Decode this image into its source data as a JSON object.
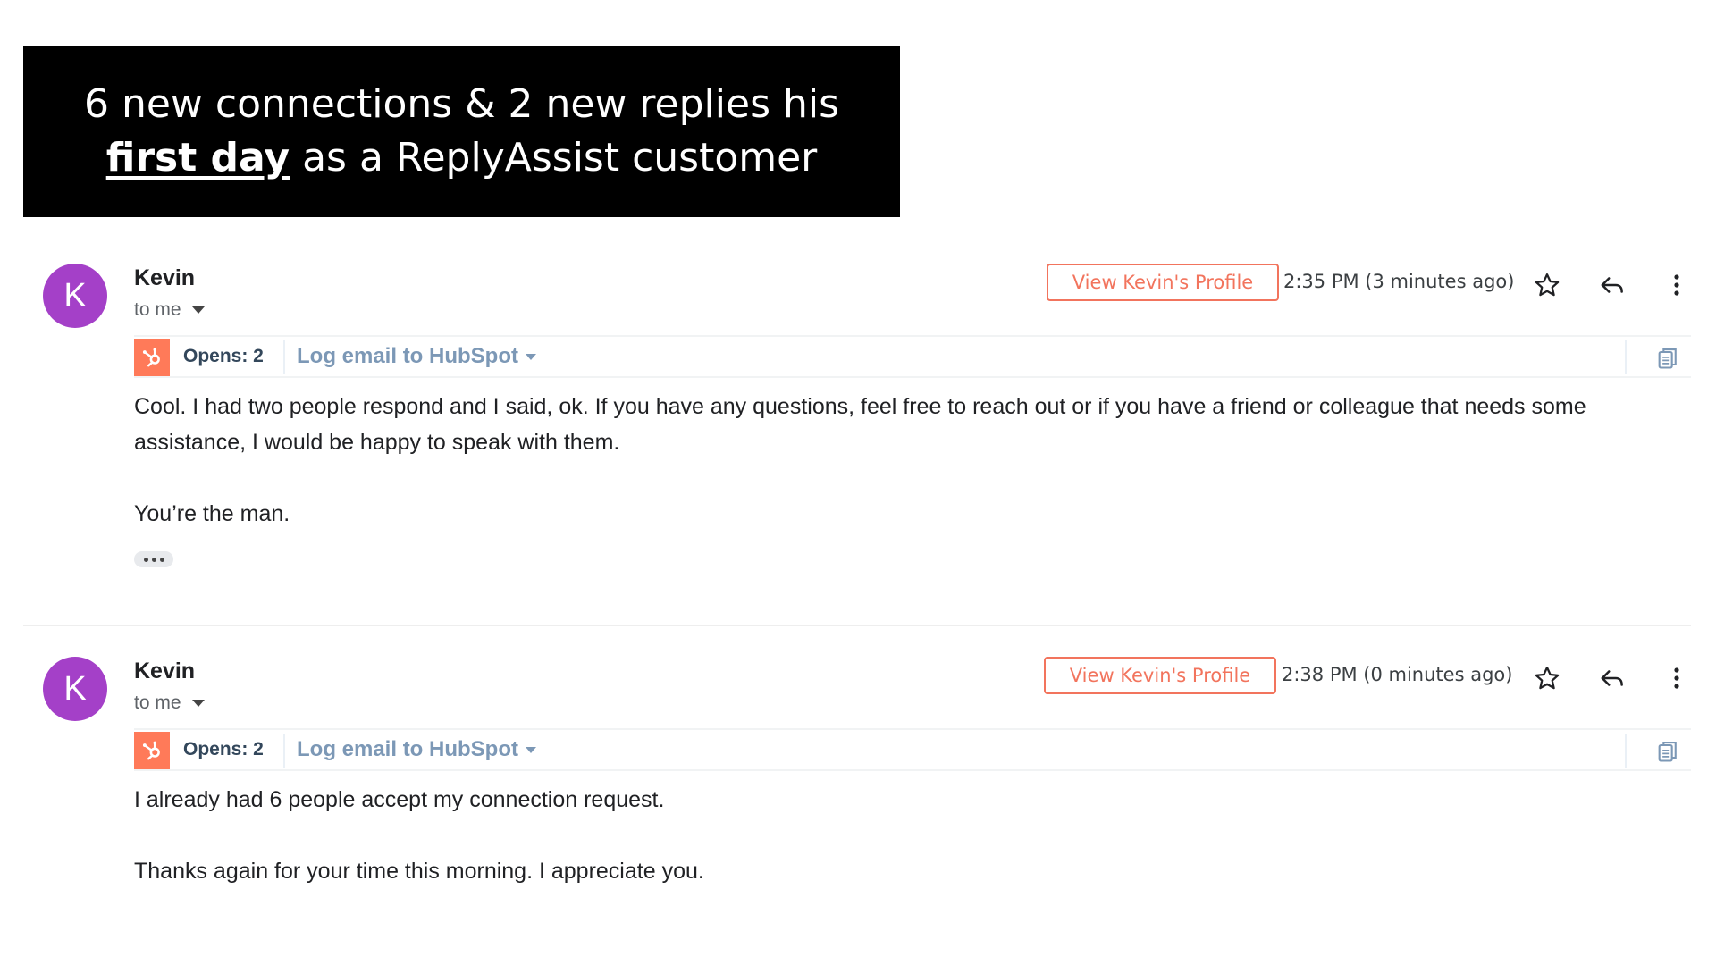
{
  "banner": {
    "line1": "6 new connections & 2 new replies his",
    "emph": "first day",
    "line2_rest": " as a ReplyAssist customer"
  },
  "colors": {
    "banner_bg": "#000000",
    "avatar": "#a440c8",
    "profile_button": "#f2745d",
    "hubspot": "#ff7a59",
    "hubspot_link": "#7c98b6"
  },
  "emails": [
    {
      "avatar_letter": "K",
      "sender": "Kevin",
      "to": "to me",
      "profile_button": "View Kevin's Profile",
      "time": "2:35 PM (3 minutes ago)",
      "opens": "Opens: 2",
      "hubspot_action": "Log email to HubSpot",
      "paragraphs": [
        "Cool.  I had two people respond and I said, ok.  If you have any questions, feel free to reach out or if you have a friend or colleague that needs some assistance, I would be happy to speak with them.",
        "You’re the man."
      ]
    },
    {
      "avatar_letter": "K",
      "sender": "Kevin",
      "to": "to me",
      "profile_button": "View Kevin's Profile",
      "time": "2:38 PM (0 minutes ago)",
      "opens": "Opens: 2",
      "hubspot_action": "Log email to HubSpot",
      "paragraphs": [
        "I already had 6 people accept my connection request.",
        "Thanks again for your time this morning.  I appreciate you."
      ]
    }
  ],
  "icons": [
    "star-icon",
    "reply-icon",
    "more-vert-icon",
    "hubspot-logo-icon",
    "copy-icon",
    "chevron-down-icon",
    "ellipsis-icon"
  ]
}
